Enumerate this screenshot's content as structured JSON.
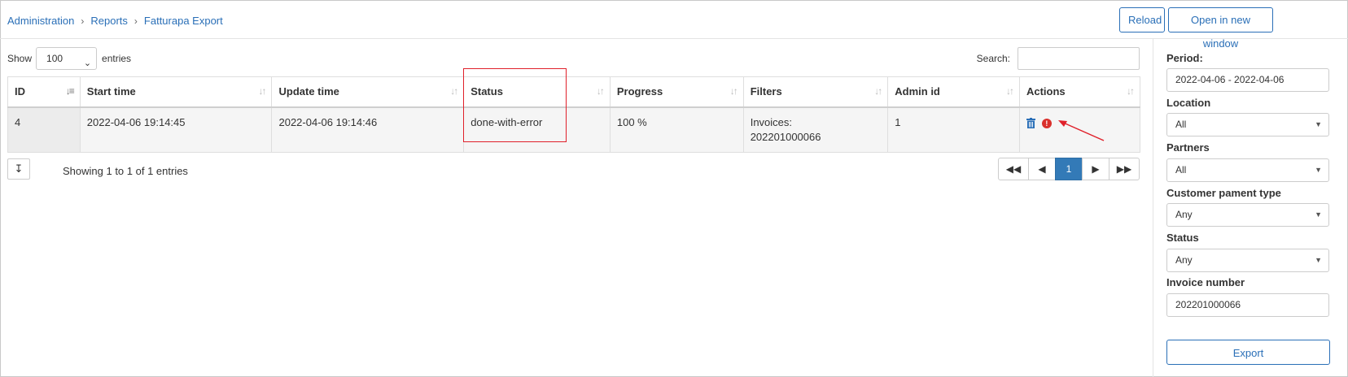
{
  "breadcrumb": [
    "Administration",
    "Reports",
    "Fatturapa Export"
  ],
  "header": {
    "reload_label": "Reload",
    "open_new_window_label": "Open in new window"
  },
  "table_controls": {
    "show_label": "Show",
    "entries_value": "100",
    "entries_label": "entries",
    "search_label": "Search:",
    "search_value": ""
  },
  "columns": [
    "ID",
    "Start time",
    "Update time",
    "Status",
    "Progress",
    "Filters",
    "Admin id",
    "Actions"
  ],
  "rows": [
    {
      "id": "4",
      "start_time": "2022-04-06 19:14:45",
      "update_time": "2022-04-06 19:14:46",
      "status": "done-with-error",
      "progress": "100 %",
      "filters_line1": "Invoices:",
      "filters_line2": "202201000066",
      "admin_id": "1",
      "actions": [
        "trash-icon",
        "error-icon"
      ]
    }
  ],
  "footer": {
    "info": "Showing 1 to 1 of 1 entries",
    "current_page": "1"
  },
  "sidebar": {
    "period_label": "Period:",
    "period_value": "2022-04-06 - 2022-04-06",
    "location_label": "Location",
    "location_value": "All",
    "partners_label": "Partners",
    "partners_value": "All",
    "payment_type_label": "Customer pament type",
    "payment_type_value": "Any",
    "status_label": "Status",
    "status_value": "Any",
    "invoice_label": "Invoice number",
    "invoice_value": "202201000066",
    "export_label": "Export"
  },
  "colors": {
    "accent": "#2a6fb7",
    "active_page": "#337ab7",
    "highlight": "#e0202a"
  }
}
